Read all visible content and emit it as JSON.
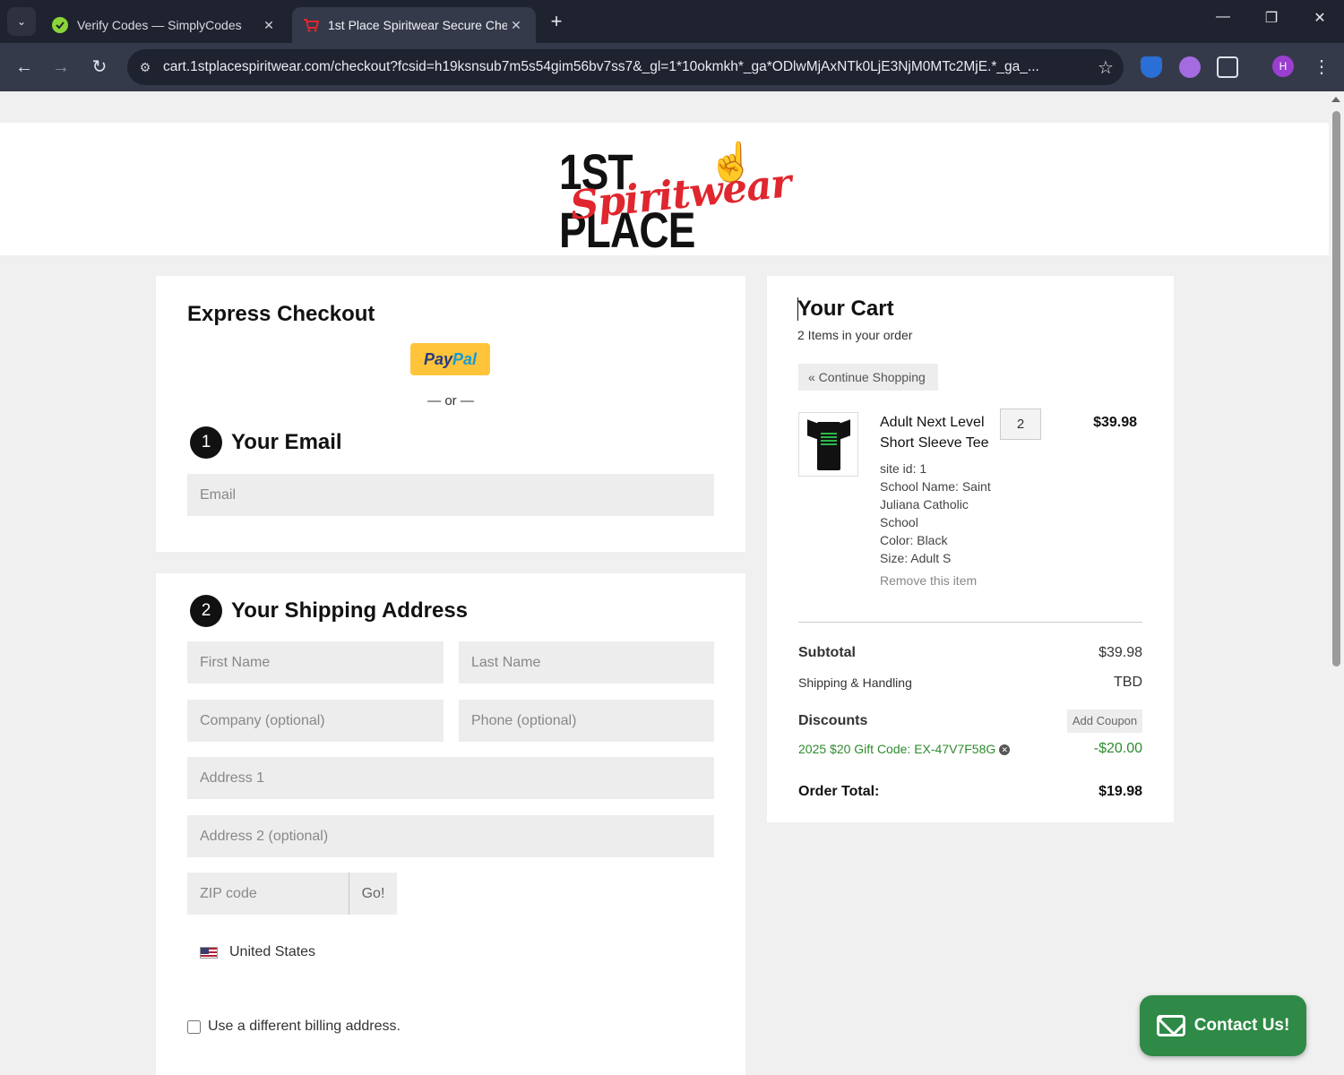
{
  "browser": {
    "tabs": [
      {
        "title": "Verify Codes — SimplyCodes",
        "active": false
      },
      {
        "title": "1st Place Spiritwear Secure Che",
        "active": true
      }
    ],
    "url": "cart.1stplacespiritwear.com/checkout?fcsid=h19ksnsub7m5s54gim56bv7ss7&_gl=1*10okmkh*_ga*ODlwMjAxNTk0LjE3NjM0MTc2MjE.*_ga_...",
    "profile_initial": "H"
  },
  "logo": {
    "top": "1ST PLACE",
    "script": "Spiritwear"
  },
  "express": {
    "heading": "Express Checkout",
    "paypal_a": "Pay",
    "paypal_b": "Pal",
    "or": "— or —"
  },
  "email": {
    "step": "1",
    "heading": "Your Email",
    "placeholder": "Email"
  },
  "shipping": {
    "step": "2",
    "heading": "Your Shipping Address",
    "first_name": "First Name",
    "last_name": "Last Name",
    "company": "Company (optional)",
    "phone": "Phone (optional)",
    "address1": "Address 1",
    "address2": "Address 2 (optional)",
    "zip": "ZIP code",
    "go": "Go!",
    "country": "United States",
    "billing_label": "Use a different billing address."
  },
  "cart": {
    "heading": "Your Cart",
    "items_count": "2 Items in your order",
    "continue": "« Continue Shopping",
    "item": {
      "name": "Adult Next Level Short Sleeve Tee",
      "qty": "2",
      "price": "$39.98",
      "site_id": "site id: 1",
      "school": "School Name: Saint Juliana Catholic School",
      "color": "Color: Black",
      "size": "Size: Adult S",
      "remove": "Remove this item"
    },
    "subtotal_label": "Subtotal",
    "subtotal": "$39.98",
    "shipping_label": "Shipping & Handling",
    "shipping": "TBD",
    "discounts_label": "Discounts",
    "add_coupon": "Add Coupon",
    "discount_name": "2025 $20 Gift Code: EX-47V7F58G",
    "discount_value": "-$20.00",
    "total_label": "Order Total:",
    "total": "$19.98"
  },
  "contact": {
    "label": "Contact Us!"
  }
}
